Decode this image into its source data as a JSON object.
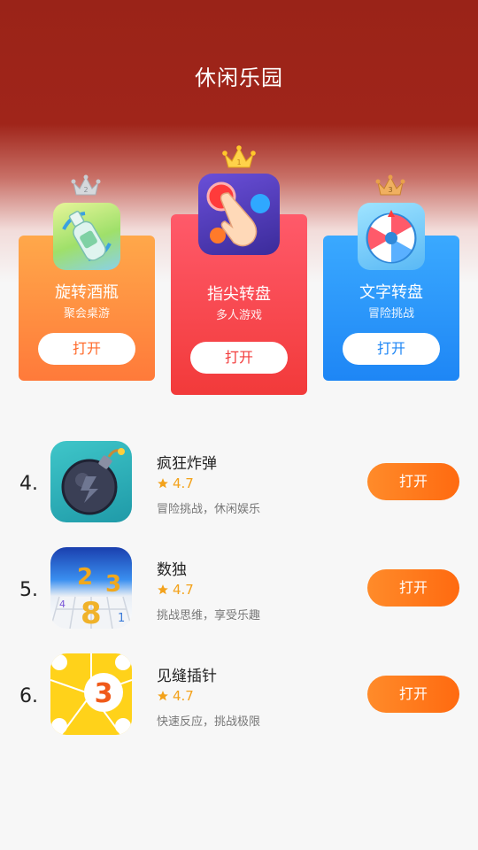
{
  "header": {
    "title": "休闲乐园"
  },
  "podium": [
    {
      "rank": "2",
      "name": "旋转酒瓶",
      "subtitle": "聚会桌游",
      "button": "打开"
    },
    {
      "rank": "1",
      "name": "指尖转盘",
      "subtitle": "多人游戏",
      "button": "打开"
    },
    {
      "rank": "3",
      "name": "文字转盘",
      "subtitle": "冒险挑战",
      "button": "打开"
    }
  ],
  "list": [
    {
      "rank": "4.",
      "name": "疯狂炸弹",
      "rating": "4.7",
      "desc": "冒险挑战，休闲娱乐",
      "button": "打开"
    },
    {
      "rank": "5.",
      "name": "数独",
      "rating": "4.7",
      "desc": "挑战思维，享受乐趣",
      "button": "打开"
    },
    {
      "rank": "6.",
      "name": "见缝插针",
      "rating": "4.7",
      "desc": "快速反应，挑战极限",
      "button": "打开"
    }
  ],
  "colors": {
    "header_red": "#9a2318",
    "card_orange": "#ff8a3a",
    "card_red": "#f23a3a",
    "card_blue": "#1e86f5",
    "button_orange": "#ff6a10",
    "star_yellow": "#f3a21b"
  },
  "icons": {
    "podium": [
      "spinning-bottle-icon",
      "finger-spinner-icon",
      "word-wheel-icon"
    ],
    "list": [
      "bomb-icon",
      "sudoku-icon",
      "pin-circle-icon"
    ],
    "crowns": [
      "silver-crown-icon",
      "gold-crown-icon",
      "bronze-crown-icon"
    ]
  }
}
